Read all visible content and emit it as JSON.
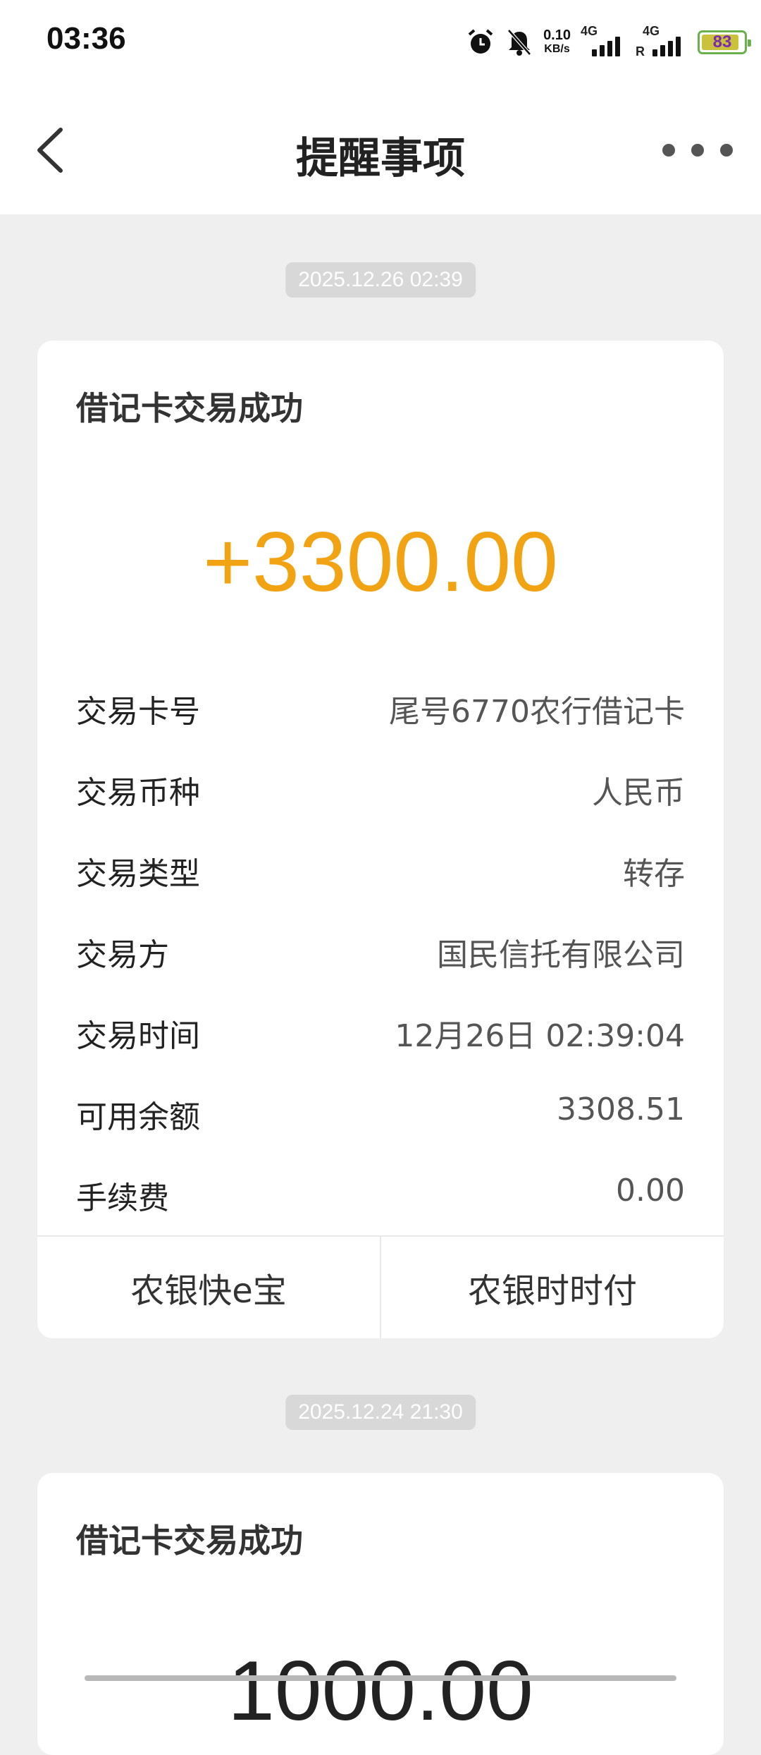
{
  "status_bar": {
    "time": "03:36",
    "net_speed_value": "0.10",
    "net_speed_unit": "KB/s",
    "network_1": "4G",
    "network_2": "4G",
    "roaming": "R",
    "battery": "83",
    "icons": [
      "alarm-icon",
      "mute-bell-icon",
      "signal-icon",
      "battery-icon"
    ]
  },
  "header": {
    "title": "提醒事项",
    "icons": [
      "back-arrow-icon",
      "more-icon"
    ]
  },
  "messages": [
    {
      "date": "2025.12.26 02:39",
      "title": "借记卡交易成功",
      "amount": "+3300.00",
      "details": [
        {
          "label": "交易卡号",
          "value": "尾号6770农行借记卡"
        },
        {
          "label": "交易币种",
          "value": "人民币"
        },
        {
          "label": "交易类型",
          "value": "转存"
        },
        {
          "label": "交易方",
          "value": "国民信托有限公司"
        },
        {
          "label": "交易时间",
          "value": "12月26日 02:39:04"
        },
        {
          "label": "可用余额",
          "value": "3308.51"
        },
        {
          "label": "手续费",
          "value": "0.00"
        }
      ],
      "actions": [
        "农银快e宝",
        "农银时时付"
      ]
    },
    {
      "date": "2025.12.24 21:30",
      "title": "借记卡交易成功",
      "amount": "1000.00"
    }
  ],
  "colors": {
    "amount": "#f2a313",
    "background": "#efefef"
  }
}
